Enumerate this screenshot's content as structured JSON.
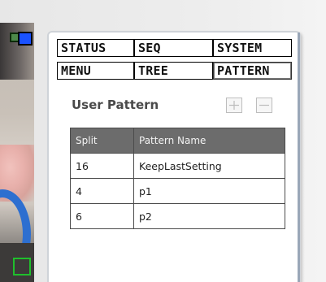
{
  "tabs": {
    "row1": [
      {
        "id": "status",
        "label": "STATUS"
      },
      {
        "id": "seq",
        "label": "SEQ"
      },
      {
        "id": "system",
        "label": "SYSTEM"
      }
    ],
    "row2": [
      {
        "id": "menu",
        "label": "MENU"
      },
      {
        "id": "tree",
        "label": "TREE"
      },
      {
        "id": "pattern",
        "label": "PATTERN",
        "active": true
      }
    ]
  },
  "section": {
    "title": "User Pattern",
    "add_icon": "plus-icon",
    "remove_icon": "minus-icon"
  },
  "table": {
    "headers": [
      "Split",
      "Pattern Name"
    ],
    "rows": [
      [
        "16",
        "KeepLastSetting"
      ],
      [
        "4",
        "p1"
      ],
      [
        "6",
        "p2"
      ]
    ]
  },
  "colors": {
    "header_bg": "#6c6c6c",
    "marker_blue": "#1a52ff",
    "marker_green": "#1fbf2c"
  }
}
